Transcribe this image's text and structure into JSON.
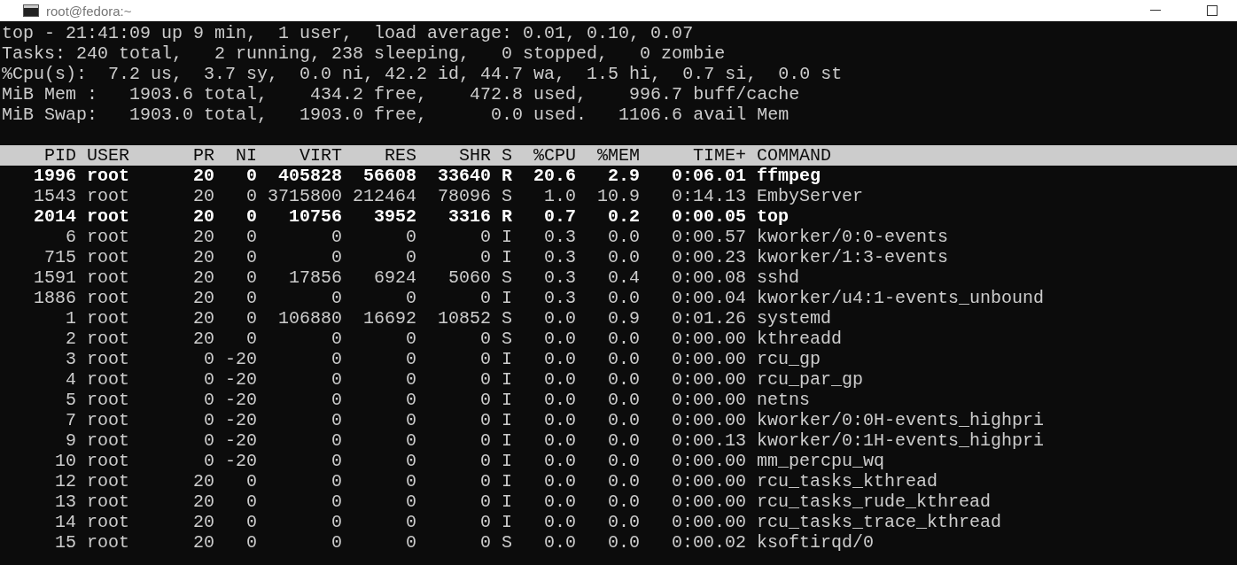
{
  "window": {
    "title": "root@fedora:~"
  },
  "summary": [
    "top - 21:41:09 up 9 min,  1 user,  load average: 0.01, 0.10, 0.07",
    "Tasks: 240 total,   2 running, 238 sleeping,   0 stopped,   0 zombie",
    "%Cpu(s):  7.2 us,  3.7 sy,  0.0 ni, 42.2 id, 44.7 wa,  1.5 hi,  0.7 si,  0.0 st",
    "MiB Mem :   1903.6 total,    434.2 free,    472.8 used,    996.7 buff/cache",
    "MiB Swap:   1903.0 total,   1903.0 free,      0.0 used.   1106.6 avail Mem"
  ],
  "table": {
    "columns": [
      "PID",
      "USER",
      "PR",
      "NI",
      "VIRT",
      "RES",
      "SHR",
      "S",
      "%CPU",
      "%MEM",
      "TIME+",
      "COMMAND"
    ],
    "rows": [
      {
        "highlighted": true,
        "cells": [
          "1996",
          "root",
          "20",
          "0",
          "405828",
          "56608",
          "33640",
          "R",
          "20.6",
          "2.9",
          "0:06.01",
          "ffmpeg"
        ]
      },
      {
        "highlighted": false,
        "cells": [
          "1543",
          "root",
          "20",
          "0",
          "3715800",
          "212464",
          "78096",
          "S",
          "1.0",
          "10.9",
          "0:14.13",
          "EmbyServer"
        ]
      },
      {
        "highlighted": true,
        "cells": [
          "2014",
          "root",
          "20",
          "0",
          "10756",
          "3952",
          "3316",
          "R",
          "0.7",
          "0.2",
          "0:00.05",
          "top"
        ]
      },
      {
        "highlighted": false,
        "cells": [
          "6",
          "root",
          "20",
          "0",
          "0",
          "0",
          "0",
          "I",
          "0.3",
          "0.0",
          "0:00.57",
          "kworker/0:0-events"
        ]
      },
      {
        "highlighted": false,
        "cells": [
          "715",
          "root",
          "20",
          "0",
          "0",
          "0",
          "0",
          "I",
          "0.3",
          "0.0",
          "0:00.23",
          "kworker/1:3-events"
        ]
      },
      {
        "highlighted": false,
        "cells": [
          "1591",
          "root",
          "20",
          "0",
          "17856",
          "6924",
          "5060",
          "S",
          "0.3",
          "0.4",
          "0:00.08",
          "sshd"
        ]
      },
      {
        "highlighted": false,
        "cells": [
          "1886",
          "root",
          "20",
          "0",
          "0",
          "0",
          "0",
          "I",
          "0.3",
          "0.0",
          "0:00.04",
          "kworker/u4:1-events_unbound"
        ]
      },
      {
        "highlighted": false,
        "cells": [
          "1",
          "root",
          "20",
          "0",
          "106880",
          "16692",
          "10852",
          "S",
          "0.0",
          "0.9",
          "0:01.26",
          "systemd"
        ]
      },
      {
        "highlighted": false,
        "cells": [
          "2",
          "root",
          "20",
          "0",
          "0",
          "0",
          "0",
          "S",
          "0.0",
          "0.0",
          "0:00.00",
          "kthreadd"
        ]
      },
      {
        "highlighted": false,
        "cells": [
          "3",
          "root",
          "0",
          "-20",
          "0",
          "0",
          "0",
          "I",
          "0.0",
          "0.0",
          "0:00.00",
          "rcu_gp"
        ]
      },
      {
        "highlighted": false,
        "cells": [
          "4",
          "root",
          "0",
          "-20",
          "0",
          "0",
          "0",
          "I",
          "0.0",
          "0.0",
          "0:00.00",
          "rcu_par_gp"
        ]
      },
      {
        "highlighted": false,
        "cells": [
          "5",
          "root",
          "0",
          "-20",
          "0",
          "0",
          "0",
          "I",
          "0.0",
          "0.0",
          "0:00.00",
          "netns"
        ]
      },
      {
        "highlighted": false,
        "cells": [
          "7",
          "root",
          "0",
          "-20",
          "0",
          "0",
          "0",
          "I",
          "0.0",
          "0.0",
          "0:00.00",
          "kworker/0:0H-events_highpri"
        ]
      },
      {
        "highlighted": false,
        "cells": [
          "9",
          "root",
          "0",
          "-20",
          "0",
          "0",
          "0",
          "I",
          "0.0",
          "0.0",
          "0:00.13",
          "kworker/0:1H-events_highpri"
        ]
      },
      {
        "highlighted": false,
        "cells": [
          "10",
          "root",
          "0",
          "-20",
          "0",
          "0",
          "0",
          "I",
          "0.0",
          "0.0",
          "0:00.00",
          "mm_percpu_wq"
        ]
      },
      {
        "highlighted": false,
        "cells": [
          "12",
          "root",
          "20",
          "0",
          "0",
          "0",
          "0",
          "I",
          "0.0",
          "0.0",
          "0:00.00",
          "rcu_tasks_kthread"
        ]
      },
      {
        "highlighted": false,
        "cells": [
          "13",
          "root",
          "20",
          "0",
          "0",
          "0",
          "0",
          "I",
          "0.0",
          "0.0",
          "0:00.00",
          "rcu_tasks_rude_kthread"
        ]
      },
      {
        "highlighted": false,
        "cells": [
          "14",
          "root",
          "20",
          "0",
          "0",
          "0",
          "0",
          "I",
          "0.0",
          "0.0",
          "0:00.00",
          "rcu_tasks_trace_kthread"
        ]
      },
      {
        "highlighted": false,
        "cells": [
          "15",
          "root",
          "20",
          "0",
          "0",
          "0",
          "0",
          "S",
          "0.0",
          "0.0",
          "0:00.02",
          "ksoftirqd/0"
        ]
      }
    ]
  }
}
